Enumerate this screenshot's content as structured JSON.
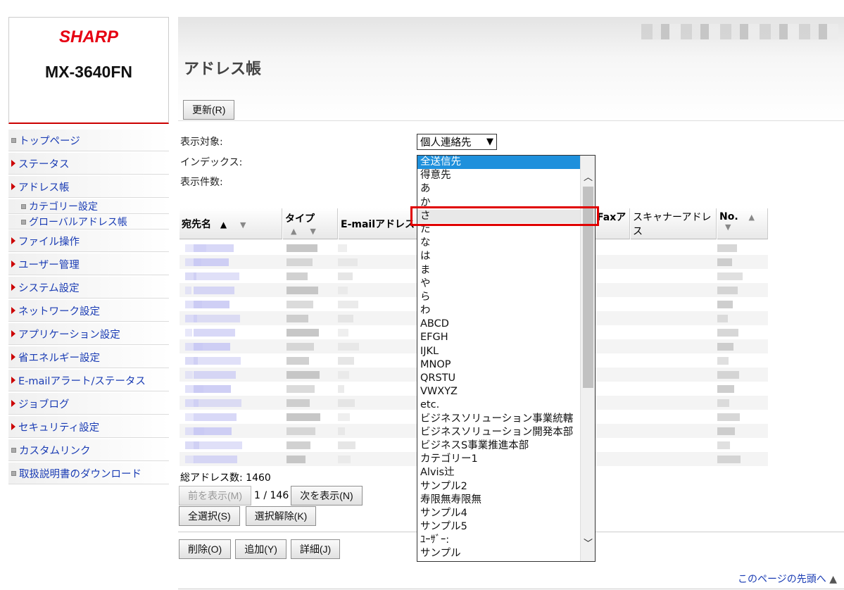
{
  "brand": "SHARP",
  "model": "MX-3640FN",
  "page_title": "アドレス帳",
  "refresh_label": "更新(R)",
  "sidebar": [
    {
      "label": "トップページ",
      "icon": "square-icon",
      "sub": false
    },
    {
      "label": "ステータス",
      "icon": "triangle-icon",
      "sub": false
    },
    {
      "label": "アドレス帳",
      "icon": "triangle-icon",
      "sub": false
    },
    {
      "label": "カテゴリー設定",
      "icon": "square-icon",
      "sub": true
    },
    {
      "label": "グローバルアドレス帳",
      "icon": "square-icon",
      "sub": true
    },
    {
      "label": "ファイル操作",
      "icon": "triangle-icon",
      "sub": false
    },
    {
      "label": "ユーザー管理",
      "icon": "triangle-icon",
      "sub": false
    },
    {
      "label": "システム設定",
      "icon": "triangle-icon",
      "sub": false
    },
    {
      "label": "ネットワーク設定",
      "icon": "triangle-icon",
      "sub": false
    },
    {
      "label": "アプリケーション設定",
      "icon": "triangle-icon",
      "sub": false
    },
    {
      "label": "省エネルギー設定",
      "icon": "triangle-icon",
      "sub": false
    },
    {
      "label": "E-mailアラート/ステータス",
      "icon": "triangle-icon",
      "sub": false
    },
    {
      "label": "ジョブログ",
      "icon": "triangle-icon",
      "sub": false
    },
    {
      "label": "セキュリティ設定",
      "icon": "triangle-icon",
      "sub": false
    },
    {
      "label": "カスタムリンク",
      "icon": "square-icon",
      "sub": false
    },
    {
      "label": "取扱説明書のダウンロード",
      "icon": "square-icon",
      "sub": false
    }
  ],
  "form": {
    "display_target_label": "表示対象:",
    "index_label": "インデックス:",
    "count_label": "表示件数:",
    "display_target_value": "個人連絡先"
  },
  "table": {
    "columns": [
      "宛先名",
      "タイプ",
      "E-mailアドレス",
      "Faxア",
      "スキャナーアドレス",
      "No."
    ],
    "sort_up": "▲",
    "sort_down": "▼"
  },
  "dropdown_items": [
    "全送信先",
    "得意先",
    "あ",
    "か",
    "さ",
    "た",
    "な",
    "は",
    "ま",
    "や",
    "ら",
    "わ",
    "ABCD",
    "EFGH",
    "IJKL",
    "MNOP",
    "QRSTU",
    "VWXYZ",
    "etc.",
    "ビジネスソリューション事業統轄",
    "ビジネスソリューション開発本部",
    "ビジネスS事業推進本部",
    "カテゴリー1",
    "Alvis辻",
    "サンプル2",
    "寿限無寿限無",
    "サンプル4",
    "サンプル5",
    "ﾕｰｻﾞｰ:",
    "サンプル"
  ],
  "dropdown_selected": "全送信先",
  "dropdown_hovered": "さ",
  "total_label": "総アドレス数:",
  "total_value": "1460",
  "pager": {
    "prev": "前を表示(M)",
    "info": "1 / 146",
    "next": "次を表示(N)"
  },
  "select_all": "全選択(S)",
  "deselect": "選択解除(K)",
  "actions": {
    "delete": "削除(O)",
    "add": "追加(Y)",
    "detail": "詳細(J)"
  },
  "to_top": "このページの先頭へ",
  "colors": {
    "brand_red": "#e60012",
    "link_blue": "#1a3cb4",
    "selection_blue": "#1e90dc",
    "highlight_red": "#e00000"
  }
}
